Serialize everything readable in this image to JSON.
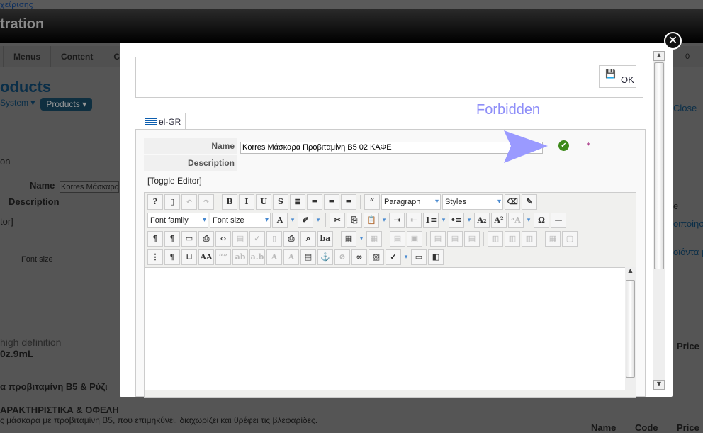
{
  "background": {
    "top_link": "χείρισης",
    "header_title": "tration",
    "menu": [
      "",
      "Menus",
      "Content",
      "Co"
    ],
    "page_title": "oducts",
    "sub_nav": {
      "system": "System ▾",
      "products": "Products ▾"
    },
    "tab": "on",
    "name_label": "Name",
    "name_value": "Korres Μάσκαρα",
    "description_label": "Description",
    "toggle": "tor]",
    "font_size": "Font size",
    "text1": "high definition",
    "text2": "0z.9mL",
    "text3": "α προβιταμίνη B5 & Ρύζι",
    "text4": "ΑΡΑΚΤΗΡΙΣΤΙΚΑ & ΟΦΕΛΗ",
    "text5": "ς μάσκαρα με προβιταμίνη B5, που επιμηκύνει, διαχωρίζει και θρέφει τις βλεφαρίδες.",
    "right_close": "Close",
    "right_counter": "0",
    "right_col": "e",
    "right_row1": "οιποίηση",
    "right_row2": "οϊόντα μ",
    "price": "Price",
    "cols": [
      "Name",
      "Code",
      "Price"
    ]
  },
  "modal": {
    "ok_label": "OK",
    "forbidden": "Forbidden",
    "tab_label": "el-GR",
    "name_label": "Name",
    "name_value": "Korres Μάσκαρα Προβιταμίνη B5 02 ΚΑΦΕ",
    "required_mark": "*",
    "description_label": "Description",
    "toggle_editor": "[Toggle Editor]",
    "toolbar": [
      [
        {
          "icon": "help"
        },
        {
          "icon": "new-document"
        },
        {
          "icon": "undo",
          "disabled": true
        },
        {
          "icon": "redo",
          "disabled": true
        },
        {
          "sep": true
        },
        {
          "icon": "bold"
        },
        {
          "icon": "italic"
        },
        {
          "icon": "underline"
        },
        {
          "icon": "strikethrough"
        },
        {
          "icon": "justify"
        },
        {
          "icon": "align-center"
        },
        {
          "icon": "align-left"
        },
        {
          "icon": "align-right"
        },
        {
          "sep": true
        },
        {
          "icon": "blockquote"
        },
        {
          "select": "Paragraph",
          "w": 84
        },
        {
          "select": "Styles",
          "w": 86
        },
        {
          "icon": "eraser"
        },
        {
          "icon": "cleanup"
        }
      ],
      [
        {
          "select": "Font family",
          "w": 86
        },
        {
          "select": "Font size",
          "w": 86
        },
        {
          "icon": "text-color",
          "drop": true
        },
        {
          "icon": "highlight",
          "drop": true
        },
        {
          "sep": true
        },
        {
          "icon": "cut"
        },
        {
          "icon": "copy"
        },
        {
          "icon": "paste",
          "drop": true
        },
        {
          "icon": "indent"
        },
        {
          "icon": "outdent",
          "disabled": true
        },
        {
          "icon": "numbered-list",
          "drop": true
        },
        {
          "icon": "bullet-list",
          "drop": true
        },
        {
          "icon": "subscript"
        },
        {
          "icon": "superscript"
        },
        {
          "icon": "case",
          "disabled": true,
          "drop": true
        },
        {
          "icon": "special-char"
        },
        {
          "icon": "horizontal-rule"
        }
      ],
      [
        {
          "icon": "ltr"
        },
        {
          "icon": "rtl"
        },
        {
          "icon": "fullscreen"
        },
        {
          "icon": "preview"
        },
        {
          "icon": "source-code"
        },
        {
          "icon": "template",
          "disabled": true
        },
        {
          "icon": "spellcheck-doc",
          "disabled": true
        },
        {
          "icon": "blank",
          "disabled": true
        },
        {
          "icon": "print"
        },
        {
          "icon": "find"
        },
        {
          "icon": "replace"
        },
        {
          "sep": true
        },
        {
          "icon": "table",
          "drop": true
        },
        {
          "icon": "delete-table",
          "disabled": true
        },
        {
          "sep": true
        },
        {
          "icon": "row-props",
          "disabled": true
        },
        {
          "icon": "cell-props",
          "disabled": true
        },
        {
          "sep": true
        },
        {
          "icon": "insert-row-before",
          "disabled": true
        },
        {
          "icon": "insert-row-after",
          "disabled": true
        },
        {
          "icon": "delete-row",
          "disabled": true
        },
        {
          "sep": true
        },
        {
          "icon": "insert-col-before",
          "disabled": true
        },
        {
          "icon": "insert-col-after",
          "disabled": true
        },
        {
          "icon": "delete-col",
          "disabled": true
        },
        {
          "sep": true
        },
        {
          "icon": "split-cells",
          "disabled": true
        },
        {
          "icon": "merge-cells",
          "disabled": true
        }
      ],
      [
        {
          "icon": "visual-aid"
        },
        {
          "icon": "show-blocks"
        },
        {
          "icon": "page-break"
        },
        {
          "icon": "styles-aa"
        },
        {
          "icon": "cite",
          "disabled": true
        },
        {
          "icon": "abbr",
          "disabled": true
        },
        {
          "icon": "acronym",
          "disabled": true
        },
        {
          "icon": "del",
          "disabled": true
        },
        {
          "icon": "ins",
          "disabled": true
        },
        {
          "icon": "attributes"
        },
        {
          "icon": "anchor"
        },
        {
          "icon": "unlink",
          "disabled": true
        },
        {
          "icon": "link"
        },
        {
          "icon": "image"
        },
        {
          "icon": "spellchecker",
          "drop": true
        },
        {
          "icon": "layer"
        },
        {
          "icon": "absolute"
        }
      ]
    ]
  }
}
